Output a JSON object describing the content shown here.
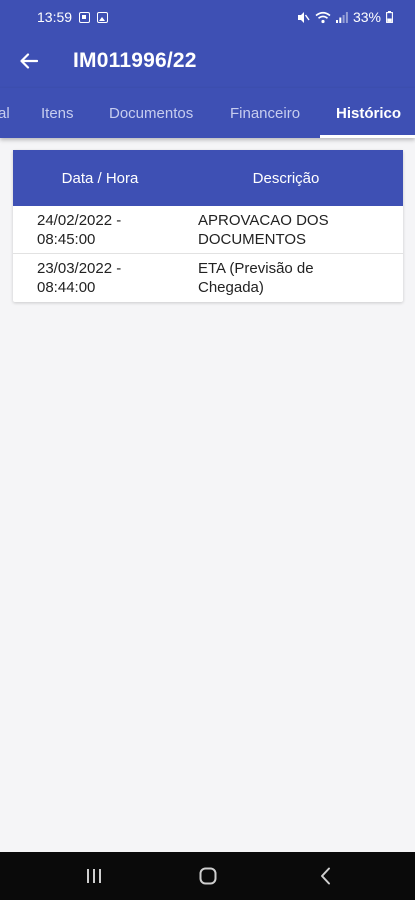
{
  "status_bar": {
    "time": "13:59",
    "battery": "33%",
    "left_icons": [
      "message-icon",
      "photo-icon"
    ],
    "right_icons": [
      "mute-icon",
      "wifi-icon",
      "signal-icon",
      "battery-icon"
    ]
  },
  "app_bar": {
    "title": "IM011996/22",
    "back_icon": "arrow-left-icon"
  },
  "tabs": [
    {
      "label": "al",
      "active": false
    },
    {
      "label": "Itens",
      "active": false
    },
    {
      "label": "Documentos",
      "active": false
    },
    {
      "label": "Financeiro",
      "active": false
    },
    {
      "label": "Histórico",
      "active": true
    }
  ],
  "table": {
    "headers": {
      "date": "Data / Hora",
      "description": "Descrição"
    },
    "rows": [
      {
        "date_line1": "24/02/2022 -",
        "date_line2": "08:45:00",
        "desc_line1": "APROVACAO DOS",
        "desc_line2": "DOCUMENTOS"
      },
      {
        "date_line1": "23/03/2022 -",
        "date_line2": "08:44:00",
        "desc_line1": "ETA (Previsão de",
        "desc_line2": "Chegada)"
      }
    ]
  },
  "nav_bar": {
    "icons": [
      "recent-apps-icon",
      "home-icon",
      "back-icon"
    ]
  },
  "colors": {
    "primary": "#3e50b4",
    "background": "#f5f5f7",
    "nav_bar": "#0a0a0a"
  }
}
